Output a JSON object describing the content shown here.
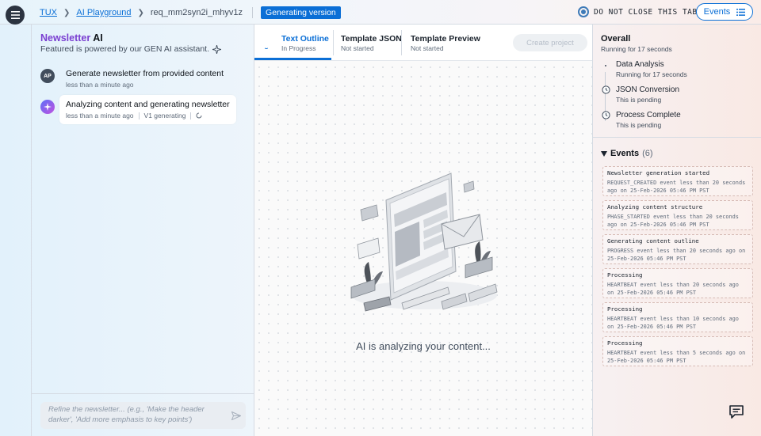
{
  "breadcrumb": {
    "root": "TUX",
    "playground": "AI Playground",
    "request_id": "req_mm2syn2i_mhyv1z"
  },
  "status_badge": "Generating version",
  "warning_text": "DO NOT CLOSE THIS TAB",
  "events_button": "Events",
  "chat": {
    "title_brand": "Newsletter",
    "title_suffix": "AI",
    "subtitle": "Featured is powered by our GEN AI assistant.",
    "messages": [
      {
        "avatar": "AP",
        "text": "Generate newsletter from provided content",
        "time": "less than a minute ago"
      },
      {
        "text": "Analyzing content and generating newsletter",
        "time": "less than a minute ago",
        "status": "V1 generating"
      }
    ],
    "placeholder": "Refine the newsletter... (e.g., 'Make the header darker', 'Add more emphasis to key points')"
  },
  "tabs": [
    {
      "label": "Text Outline",
      "status": "In Progress"
    },
    {
      "label": "Template JSON",
      "status": "Not started"
    },
    {
      "label": "Template Preview",
      "status": "Not started"
    }
  ],
  "create_button": "Create project",
  "analyzing_text": "AI is analyzing your content...",
  "overall": {
    "title": "Overall",
    "subtitle": "Running for 17 seconds",
    "steps": [
      {
        "title": "Data Analysis",
        "status": "Running for 17 seconds"
      },
      {
        "title": "JSON Conversion",
        "status": "This is pending"
      },
      {
        "title": "Process Complete",
        "status": "This is pending"
      }
    ]
  },
  "events": {
    "title": "Events",
    "count": "(6)",
    "items": [
      {
        "title": "Newsletter generation started",
        "desc": "REQUEST_CREATED event less than 20 seconds ago on 25-Feb-2026 05:46 PM PST"
      },
      {
        "title": "Analyzing content structure",
        "desc": "PHASE_STARTED event less than 20 seconds ago on 25-Feb-2026 05:46 PM PST"
      },
      {
        "title": "Generating content outline",
        "desc": "PROGRESS event less than 20 seconds ago on 25-Feb-2026 05:46 PM PST"
      },
      {
        "title": "Processing",
        "desc": "HEARTBEAT event less than 20 seconds ago on 25-Feb-2026 05:46 PM PST"
      },
      {
        "title": "Processing",
        "desc": "HEARTBEAT event less than 10 seconds ago on 25-Feb-2026 05:46 PM PST"
      },
      {
        "title": "Processing",
        "desc": "HEARTBEAT event less than 5 seconds ago on 25-Feb-2026 05:46 PM PST"
      }
    ]
  },
  "colors": {
    "accent": "#0b6fd6",
    "brand_purple": "#7a3fd1"
  }
}
